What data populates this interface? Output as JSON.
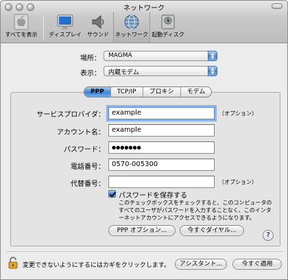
{
  "window": {
    "title": "ネットワーク"
  },
  "toolbar": {
    "items": [
      {
        "label": "すべてを表示",
        "icon": "apple-icon"
      },
      {
        "label": "ディスプレイ",
        "icon": "display-icon"
      },
      {
        "label": "サウンド",
        "icon": "speaker-icon"
      },
      {
        "label": "ネットワーク",
        "icon": "network-globe-icon",
        "active": true
      },
      {
        "label": "起動ディスク",
        "icon": "startup-disk-icon"
      }
    ]
  },
  "location": {
    "label": "場所：",
    "value": "MAGMA"
  },
  "show": {
    "label": "表示：",
    "value": "内蔵モデム"
  },
  "tabs": [
    {
      "label": "PPP",
      "selected": true
    },
    {
      "label": "TCP/IP",
      "selected": false
    },
    {
      "label": "プロキシ",
      "selected": false
    },
    {
      "label": "モデム",
      "selected": false
    }
  ],
  "form": {
    "provider": {
      "label": "サービスプロバイダ：",
      "value": "example",
      "hint": "（オプション）"
    },
    "account": {
      "label": "アカウント名：",
      "value": "example"
    },
    "password": {
      "label": "パスワード：",
      "value": "●●●●●●●"
    },
    "phone": {
      "label": "電話番号：",
      "value": "0570-005300"
    },
    "alt_phone": {
      "label": "代替番号：",
      "value": "",
      "hint": "（オプション）"
    },
    "save_password": {
      "label": "パスワードを保存する",
      "checked": true,
      "description": "このチェックボックスをチェックすると、このコンピュータのすべてのユーザがパスワードを入力することなく、このインターネットアカウントにアクセスできるようになります。"
    }
  },
  "buttons": {
    "ppp_options": "PPP オプション...",
    "dial_now": "今すぐダイヤル...",
    "help": "?",
    "assistant": "アシスタント...",
    "apply_now": "今すぐ適用"
  },
  "footer": {
    "lock_text": "変更できないようにするにはカギをクリックします。"
  },
  "colors": {
    "accent": "#3d7fd2",
    "focus_ring": "#8bb6ea"
  }
}
